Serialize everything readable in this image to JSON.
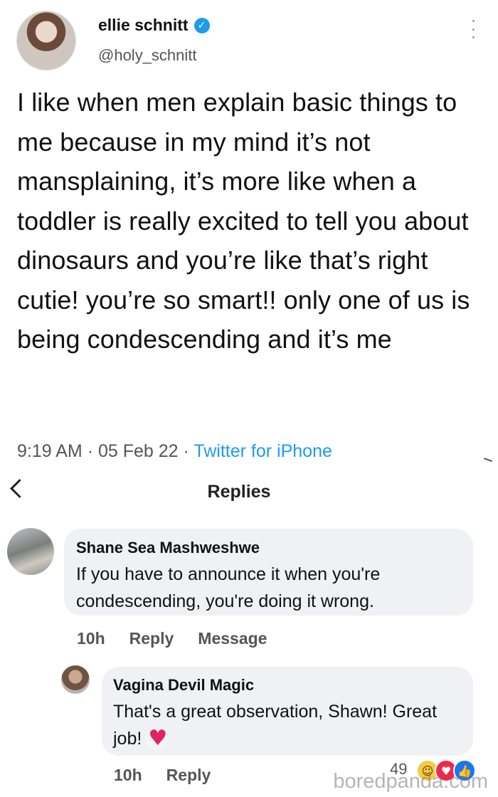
{
  "tweet": {
    "author_name": "ellie schnitt",
    "handle": "@holy_schnitt",
    "text": "I like when men explain basic things to me because in my mind it’s not mansplaining, it’s more like when a toddler is really excited to tell you about dinosaurs and you’re like that’s right cutie! you’re so smart!! only one of us is being condescending and it’s me",
    "time": "9:19 AM",
    "date": "05 Feb 22",
    "source": "Twitter for iPhone"
  },
  "replies_header": {
    "title": "Replies"
  },
  "comments": [
    {
      "author": "Shane Sea Mashweshwe",
      "text": "If you have to announce it when you're condescending, you're doing it wrong.",
      "age": "10h",
      "reply_label": "Reply",
      "message_label": "Message"
    },
    {
      "author": "Vagina Devil Magic",
      "text": "That's a great observation, Shawn! Great job!",
      "age": "10h",
      "reply_label": "Reply",
      "reaction_count": "49"
    }
  ],
  "watermark": "boredpanda.com",
  "colors": {
    "link_blue": "#1d9bf0",
    "bubble_bg": "#eff1f4",
    "heart_red": "#e0245e"
  }
}
